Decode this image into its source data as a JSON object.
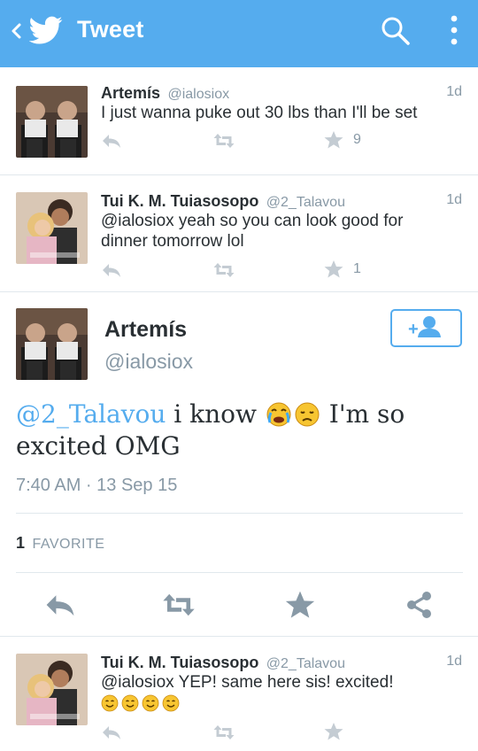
{
  "appbar": {
    "title": "Tweet",
    "bg_color": "#55acee",
    "icons": [
      "back-chevron-icon",
      "twitter-bird-icon",
      "search-icon",
      "overflow-menu-icon"
    ]
  },
  "colors": {
    "accent": "#55acee",
    "text": "#292f33",
    "muted": "#8899a6",
    "divider": "#e1e8ed"
  },
  "replies_above": [
    {
      "name": "Artemís",
      "handle": "@ialosiox",
      "time": "1d",
      "text": "I just wanna puke out 30 lbs than I'll be set",
      "favorite_count": "9"
    },
    {
      "name": "Tui K. M. Tuiasosopo",
      "handle": "@2_Talavou",
      "time": "1d",
      "text_line1": "@ialosiox yeah so you can look good for",
      "text_line2": "dinner tomorrow lol",
      "favorite_count": "1"
    }
  ],
  "focused": {
    "name": "Artemís",
    "handle": "@ialosiox",
    "mention": "@2_Talavou",
    "text_part1": " i know ",
    "text_part2": " I'm so",
    "text_line2": "excited OMG",
    "emojis": [
      "crying-face-emoji",
      "weary-face-emoji"
    ],
    "timestamp": "7:40 AM · 13 Sep 15",
    "favorites_count": "1",
    "favorites_label": "FAVORITE",
    "actions": [
      "reply-icon",
      "retweet-icon",
      "favorite-icon",
      "share-icon"
    ]
  },
  "replies_below": [
    {
      "name": "Tui K. M. Tuiasosopo",
      "handle": "@2_Talavou",
      "time": "1d",
      "text_line1": "@ialosiox YEP! same here sis! excited!",
      "emojis": [
        "smile-emoji",
        "smile-emoji",
        "smile-emoji",
        "smile-emoji"
      ]
    }
  ]
}
